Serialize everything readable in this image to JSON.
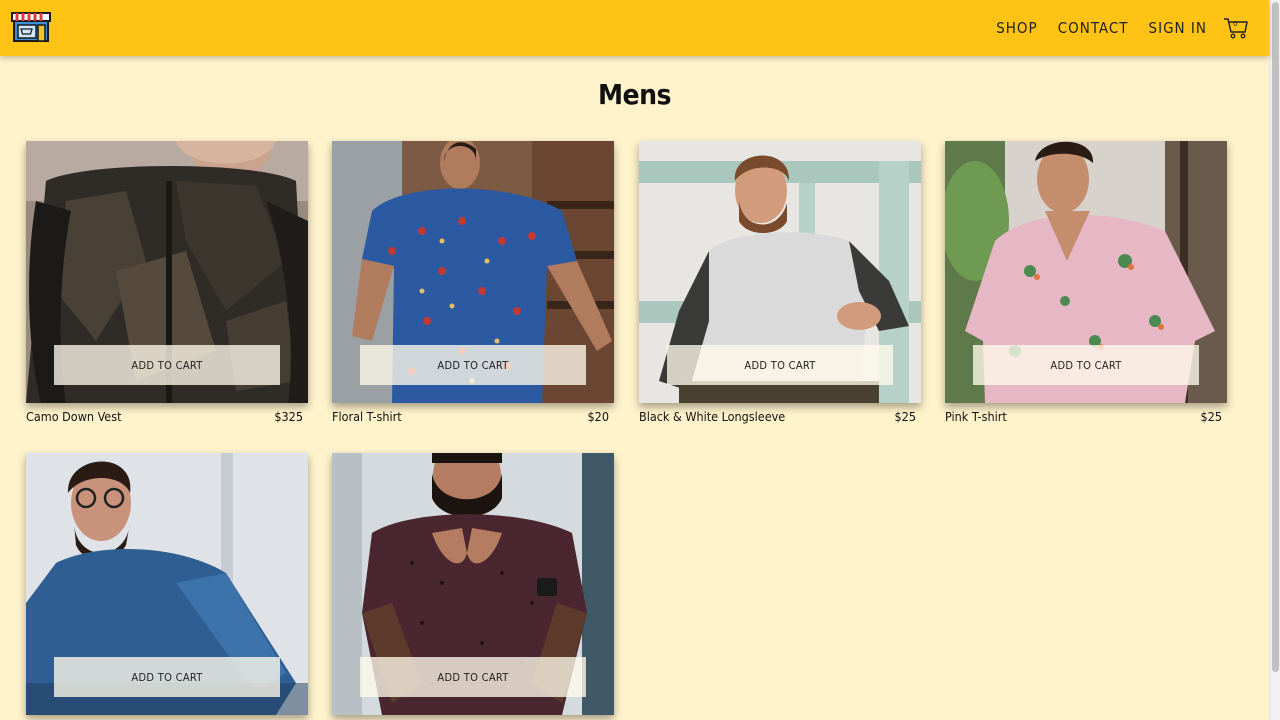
{
  "header": {
    "logo_icon": "storefront-icon",
    "nav": [
      "SHOP",
      "CONTACT",
      "SIGN IN"
    ],
    "cart_icon": "shopping-cart-icon",
    "cart_count": "0",
    "background": "#fec314"
  },
  "page": {
    "title": "Mens",
    "background": "#fff3cc"
  },
  "products": [
    {
      "name": "Camo Down Vest",
      "price": "$325",
      "button": "ADD TO CART"
    },
    {
      "name": "Floral T-shirt",
      "price": "$20",
      "button": "ADD TO CART"
    },
    {
      "name": "Black & White Longsleeve",
      "price": "$25",
      "button": "ADD TO CART"
    },
    {
      "name": "Pink T-shirt",
      "price": "$25",
      "button": "ADD TO CART"
    },
    {
      "name": "",
      "price": "",
      "button": "ADD TO CART"
    },
    {
      "name": "",
      "price": "",
      "button": "ADD TO CART"
    }
  ]
}
